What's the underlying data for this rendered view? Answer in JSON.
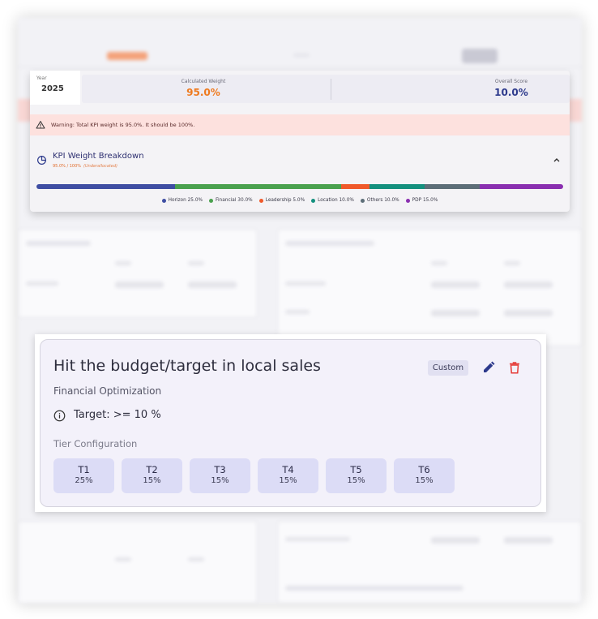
{
  "kpi_panel": {
    "year_label": "Year",
    "year_value": "2025",
    "calculated_weight_label": "Calculated Weight",
    "calculated_weight_value": "95.0%",
    "overall_score_label": "Overall Score",
    "overall_score_value": "10.0%",
    "warning_text": "Warning: Total KPI weight is 95.0%. It should be 100%.",
    "breakdown_title": "KPI Weight Breakdown",
    "breakdown_sub": "95.0% / 100%",
    "breakdown_sub_note": "(Underallocated)",
    "segments": [
      {
        "name": "Horizon",
        "label": "Horizon 25.0%",
        "value": 25.0,
        "color": "#3f4ea3"
      },
      {
        "name": "Financial",
        "label": "Financial 30.0%",
        "value": 30.0,
        "color": "#4aa14e"
      },
      {
        "name": "Leadership",
        "label": "Leadership 5.0%",
        "value": 5.0,
        "color": "#f0592a"
      },
      {
        "name": "Location",
        "label": "Location 10.0%",
        "value": 10.0,
        "color": "#14907e"
      },
      {
        "name": "Others",
        "label": "Others 10.0%",
        "value": 10.0,
        "color": "#5d6e78"
      },
      {
        "name": "PDP",
        "label": "PDP 15.0%",
        "value": 15.0,
        "color": "#8a2fb0"
      }
    ],
    "colors": {
      "calculated_weight": "#ee7a1e",
      "overall_score": "#2d3a8c"
    }
  },
  "kpi_card": {
    "title": "Hit the budget/target in local sales",
    "category": "Financial Optimization",
    "target": "Target: >= 10 %",
    "badge": "Custom",
    "tier_label": "Tier Configuration",
    "tiers": [
      {
        "name": "T1",
        "value": "25%"
      },
      {
        "name": "T2",
        "value": "15%"
      },
      {
        "name": "T3",
        "value": "15%"
      },
      {
        "name": "T4",
        "value": "15%"
      },
      {
        "name": "T5",
        "value": "15%"
      },
      {
        "name": "T6",
        "value": "15%"
      }
    ],
    "icons": {
      "info": "info-icon",
      "edit": "pencil-icon",
      "delete": "trash-icon"
    },
    "colors": {
      "edit": "#2d3a8c",
      "delete": "#e53935"
    }
  }
}
